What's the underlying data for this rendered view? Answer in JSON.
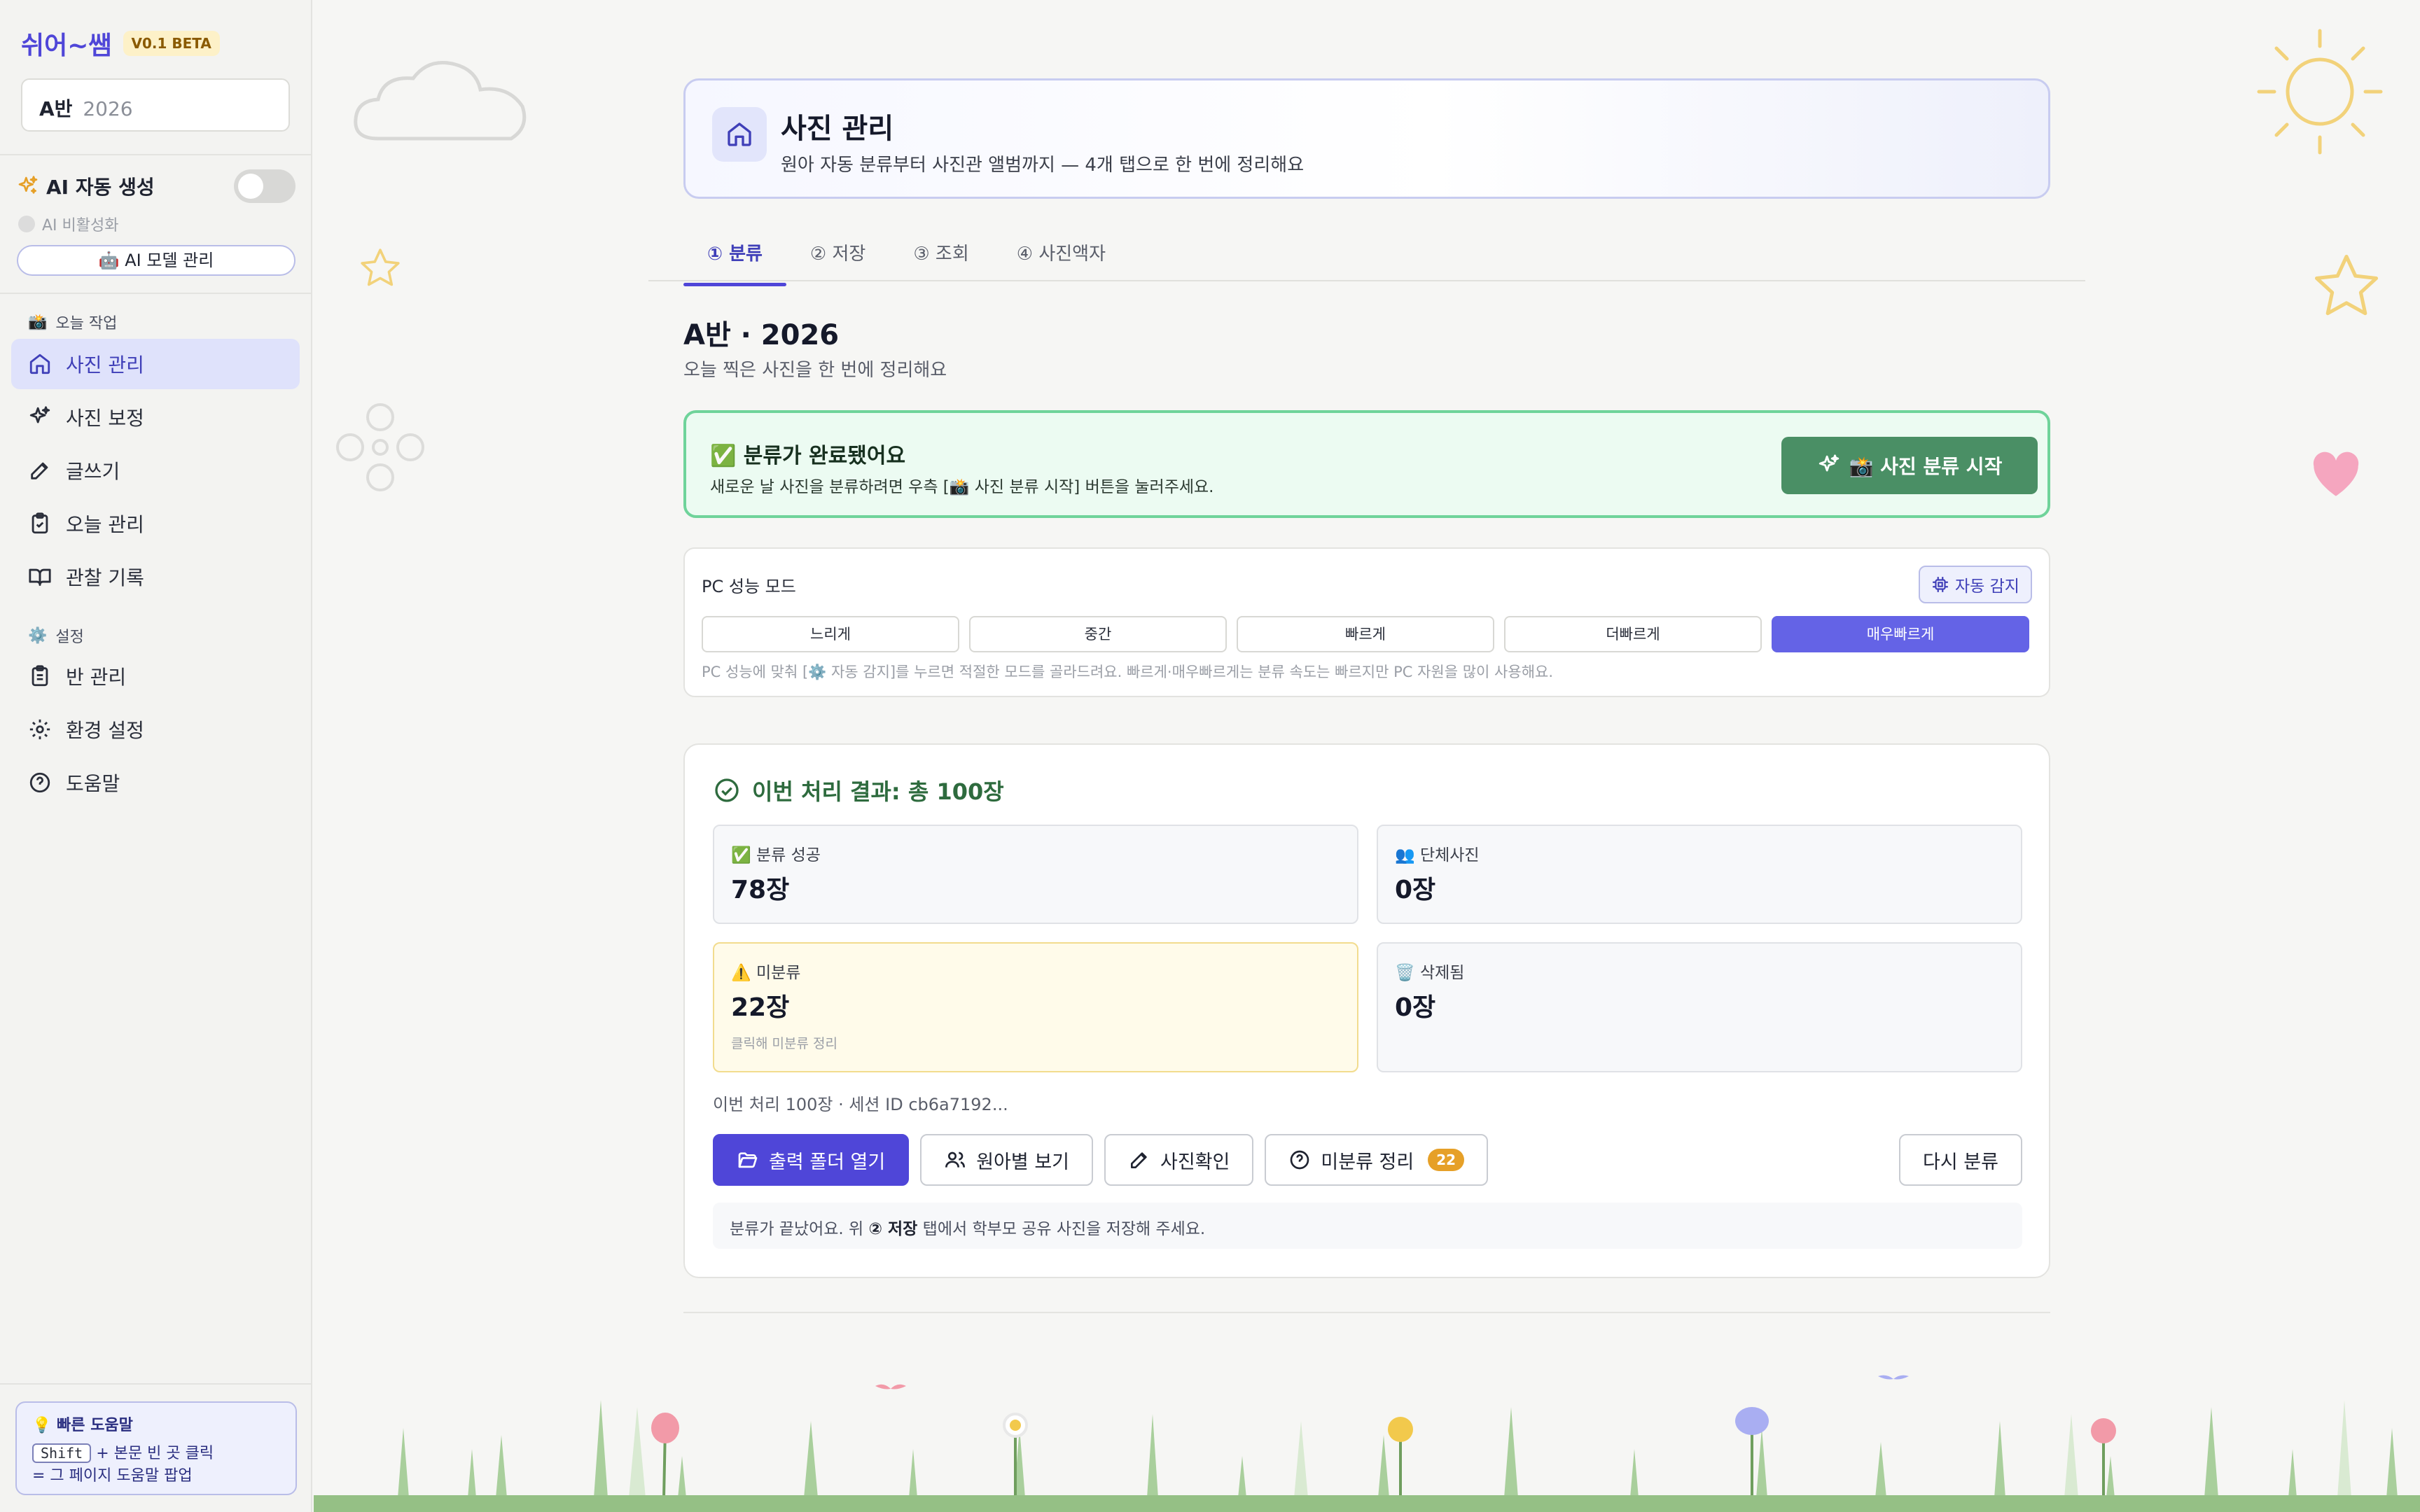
{
  "brand": {
    "name": "쉬어~쌤",
    "badge": "V0.1 BETA"
  },
  "class_selector": {
    "class_name": "A반",
    "year": "2026"
  },
  "ai": {
    "label": "AI 자동 생성",
    "status": "AI 비활성화",
    "model_button": "🤖 AI 모델 관리",
    "toggle_on": false
  },
  "sidebar": {
    "section_today": "오늘 작업",
    "section_today_icon": "📸",
    "items_today": [
      {
        "label": "사진 관리",
        "icon": "home-icon",
        "active": true
      },
      {
        "label": "사진 보정",
        "icon": "sparkles-icon",
        "active": false
      },
      {
        "label": "글쓰기",
        "icon": "pencil-icon",
        "active": false
      },
      {
        "label": "오늘 관리",
        "icon": "clipboard-check-icon",
        "active": false
      },
      {
        "label": "관찰 기록",
        "icon": "book-open-icon",
        "active": false
      }
    ],
    "section_settings": "설정",
    "section_settings_icon": "⚙️",
    "items_settings": [
      {
        "label": "반 관리",
        "icon": "clipboard-list-icon"
      },
      {
        "label": "환경 설정",
        "icon": "gear-icon"
      },
      {
        "label": "도움말",
        "icon": "help-circle-icon"
      }
    ]
  },
  "quick_help": {
    "title": "💡 빠른 도움말",
    "key": "Shift",
    "line1": "+ 본문 빈 곳 클릭",
    "line2": "= 그 페이지 도움말 팝업"
  },
  "header": {
    "title": "사진 관리",
    "subtitle": "원아 자동 분류부터 사진관 앨범까지 — 4개 탭으로 한 번에 정리해요"
  },
  "tabs": [
    {
      "label": "① 분류",
      "active": true
    },
    {
      "label": "② 저장",
      "active": false
    },
    {
      "label": "③ 조회",
      "active": false
    },
    {
      "label": "④ 사진액자",
      "active": false
    }
  ],
  "section": {
    "title": "A반 · 2026",
    "subtitle": "오늘 찍은 사진을 한 번에 정리해요"
  },
  "done_banner": {
    "title": "✅ 분류가 완료됐어요",
    "subtitle": "새로운 날 사진을 분류하려면 우측 [📸 사진 분류 시작] 버튼을 눌러주세요.",
    "button": "📸 사진 분류 시작"
  },
  "perf": {
    "title": "PC 성능 모드",
    "auto_button": "자동 감지",
    "modes": [
      "느리게",
      "중간",
      "빠르게",
      "더빠르게",
      "매우빠르게"
    ],
    "selected_mode": "매우빠르게",
    "note": "PC 성능에 맞춰 [⚙️ 자동 감지]를 누르면 적절한 모드를 골라드려요. 빠르게·매우빠르게는 분류 속도는 빠르지만 PC 자원을 많이 사용해요."
  },
  "result": {
    "title": "이번 처리 결과: 총 100장",
    "stats": {
      "success": {
        "label": "✅ 분류 성공",
        "value": "78장"
      },
      "group": {
        "label": "👥 단체사진",
        "value": "0장"
      },
      "unclassified": {
        "label": "⚠️ 미분류",
        "value": "22장",
        "hint": "클릭해 미분류 정리"
      },
      "deleted": {
        "label": "🗑️ 삭제됨",
        "value": "0장"
      }
    },
    "session": "이번 처리 100장 · 세션 ID cb6a7192...",
    "buttons": {
      "open_folder": "출력 폴더 열기",
      "by_child": "원아별 보기",
      "check": "사진확인",
      "organize": "미분류 정리",
      "organize_count": "22",
      "reclassify": "다시 분류"
    },
    "note_prefix": "분류가 끝났어요. 위 ",
    "note_bold": "② 저장",
    "note_suffix": " 탭에서 학부모 공유 사진을 저장해 주세요."
  },
  "colors": {
    "accent": "#4f46d8",
    "success": "#4a8f65",
    "warning": "#e6a028"
  }
}
